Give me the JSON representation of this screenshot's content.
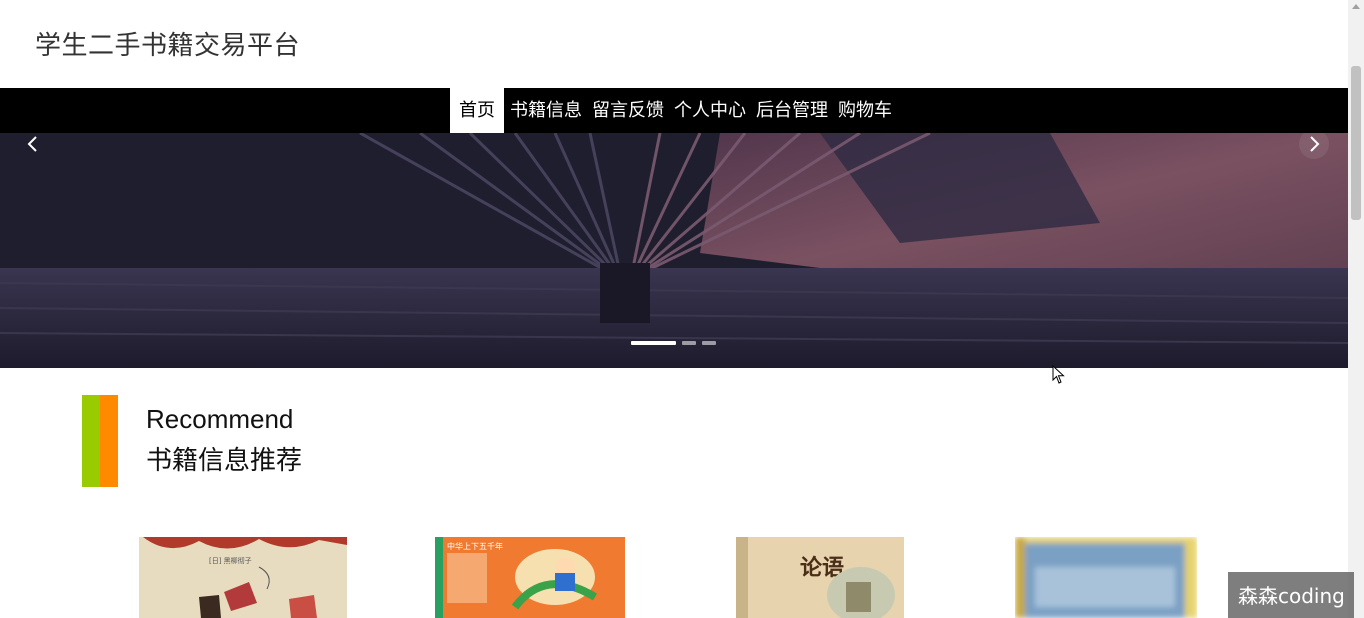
{
  "site": {
    "title": "学生二手书籍交易平台"
  },
  "nav": {
    "items": [
      {
        "label": "首页",
        "active": true
      },
      {
        "label": "书籍信息"
      },
      {
        "label": "留言反馈"
      },
      {
        "label": "个人中心"
      },
      {
        "label": "后台管理"
      },
      {
        "label": "购物车"
      }
    ]
  },
  "banner": {
    "prev_icon": "chevron-left-icon",
    "next_icon": "chevron-right-icon",
    "slide_count": 3,
    "active_slide": 1
  },
  "recommend": {
    "title_en": "Recommend",
    "title_cn": "书籍信息推荐",
    "accent_colors": [
      "#99cc00",
      "#ff8a00"
    ]
  },
  "books": [
    {
      "cover_text": "[日] 黑柳彻子"
    },
    {
      "cover_text": "中华上下五千年"
    },
    {
      "cover_text": "论语"
    },
    {
      "cover_text": ""
    }
  ],
  "watermark": {
    "text": "森森coding"
  },
  "colors": {
    "nav_bg": "#000000",
    "accent_green": "#99cc00",
    "accent_orange": "#ff8a00"
  }
}
